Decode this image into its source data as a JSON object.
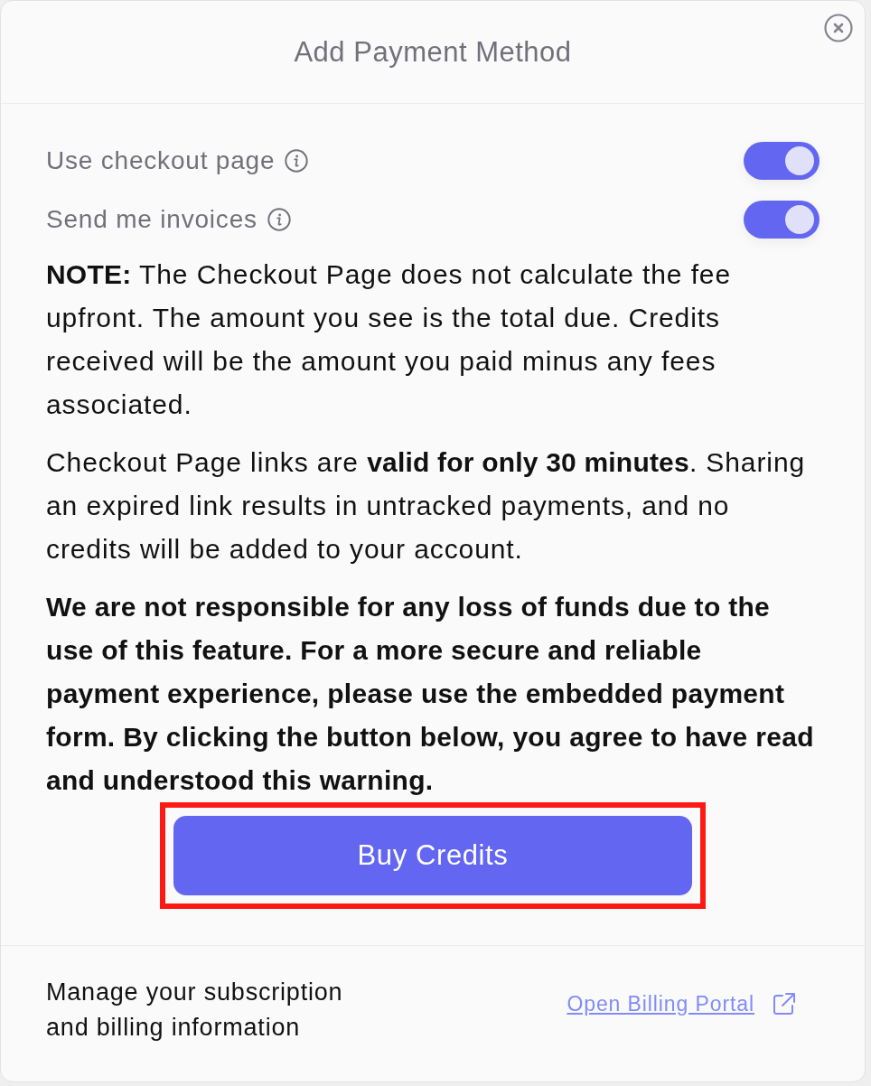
{
  "dialog": {
    "title": "Add Payment Method"
  },
  "toggles": [
    {
      "label": "Use checkout page",
      "on": true
    },
    {
      "label": "Send me invoices",
      "on": true
    }
  ],
  "paragraphs": [
    "**NOTE:** The Checkout Page does not calculate the fee upfront. The amount you see is the total due. Credits received will be the amount you paid minus any fees associated.",
    "Checkout Page links are **valid for only 30 minutes**. Sharing an expired link results in untracked payments, and no credits will be added to your account."
  ],
  "warning": "We are not responsible for any loss of funds due to the use of this feature. For a more secure and reliable payment experience, please use the embedded payment form. By clicking the button below, you agree to have read and understood this warning.",
  "buy_button": {
    "label": "Buy Credits",
    "highlighted": true
  },
  "footer": {
    "text": "Manage your subscription and billing information",
    "link": "Open Billing Portal"
  }
}
